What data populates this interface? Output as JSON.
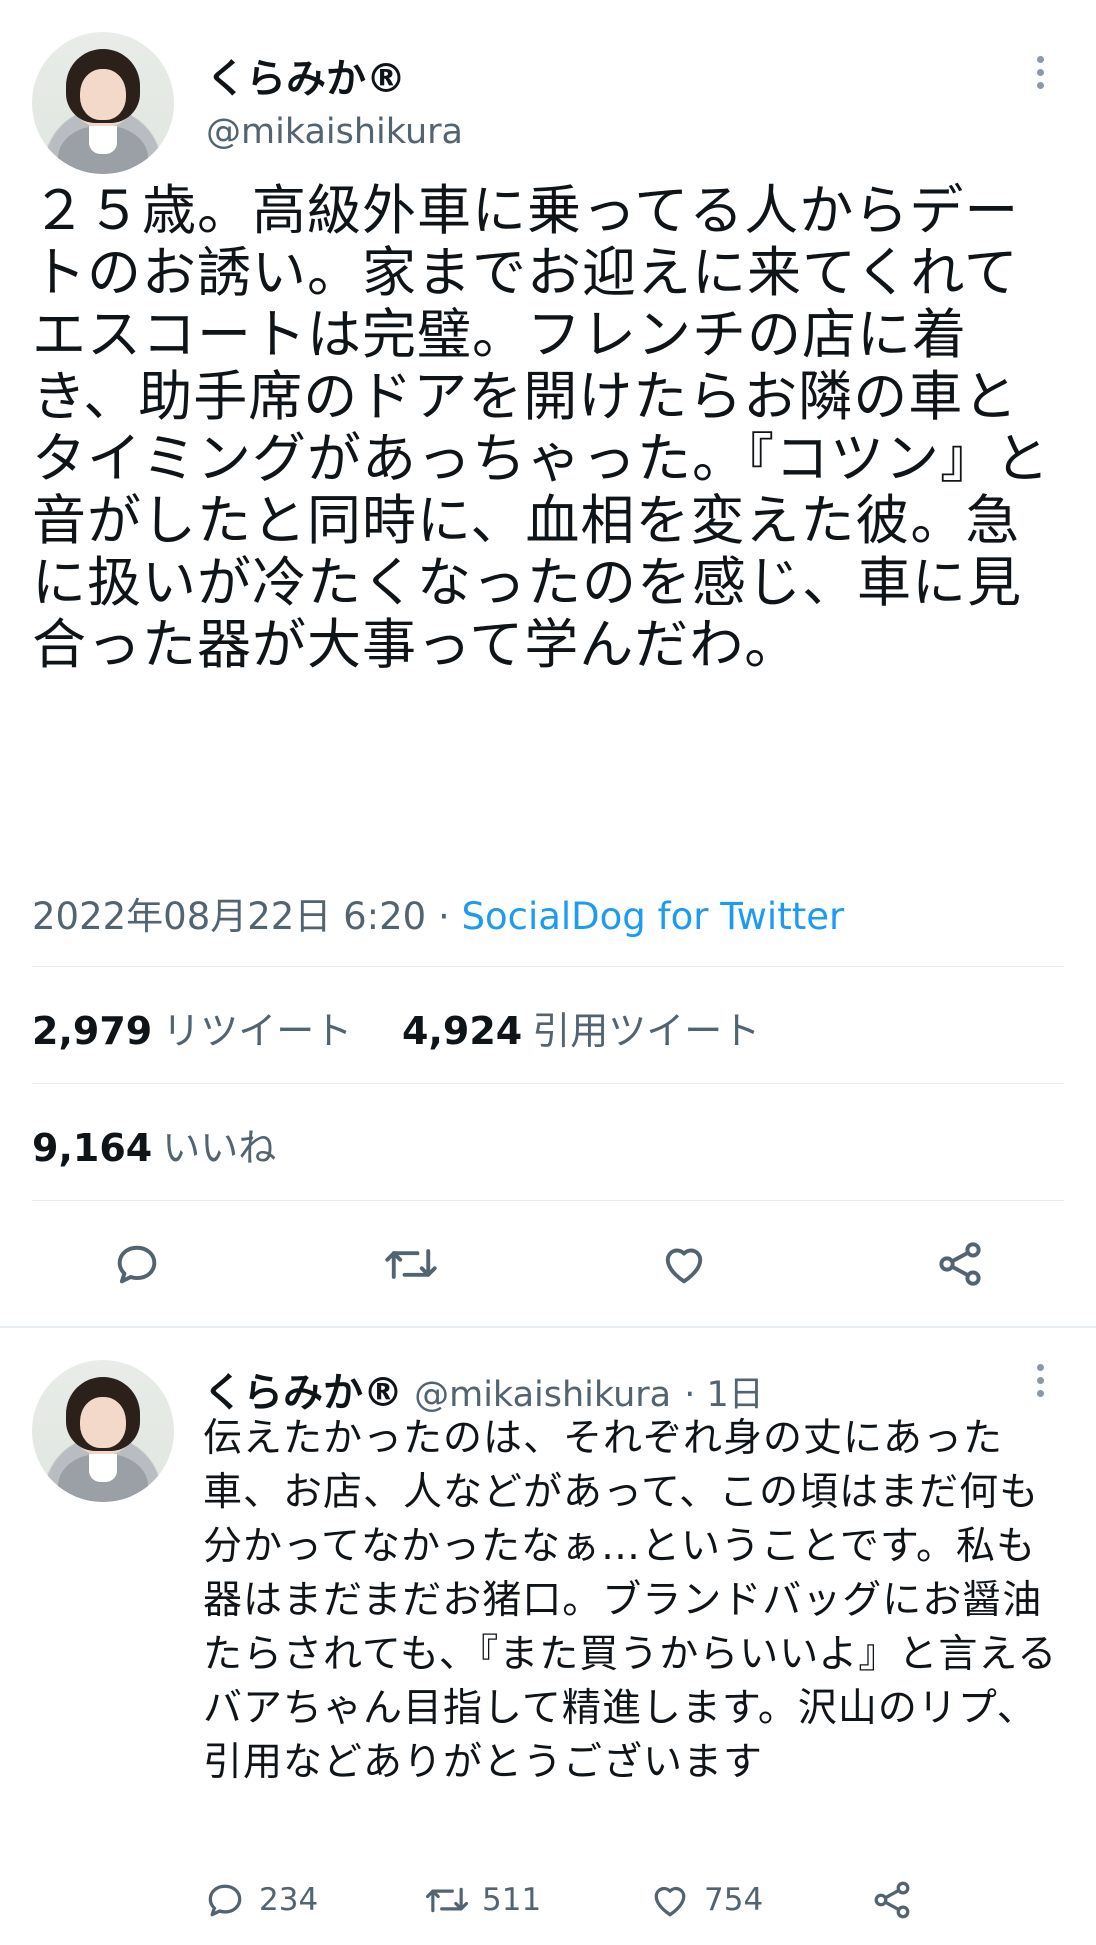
{
  "main_tweet": {
    "display_name": "くらみか®",
    "handle": "@mikaishikura",
    "text": "２５歳。高級外車に乗ってる人からデートのお誘い。家までお迎えに来てくれてエスコートは完璧。フレンチの店に着き、助手席のドアを開けたらお隣の車とタイミングがあっちゃった。『コツン』と音がしたと同時に、血相を変えた彼。急に扱いが冷たくなったのを感じ、車に見合った器が大事って学んだわ。",
    "timestamp": "2022年08月22日 6:20",
    "separator": "·",
    "source": "SocialDog for Twitter",
    "stats": {
      "retweets_count": "2,979",
      "retweets_label": "リツイート",
      "quotes_count": "4,924",
      "quotes_label": "引用ツイート",
      "likes_count": "9,164",
      "likes_label": "いいね"
    }
  },
  "reply_tweet": {
    "display_name": "くらみか®",
    "handle": "@mikaishikura",
    "time": "· 1日",
    "text": "伝えたかったのは、それぞれ身の丈にあった車、お店、人などがあって、この頃はまだ何も分かってなかったなぁ…ということです。私も器はまだまだお猪口。ブランドバッグにお醤油たらされても、『また買うからいいよ』と言えるバアちゃん目指して精進します。沢山のリプ、引用などありがとうございます",
    "counts": {
      "replies": "234",
      "retweets": "511",
      "likes": "754"
    }
  },
  "icons": [
    "reply-icon",
    "retweet-icon",
    "like-icon",
    "share-icon",
    "more-options-icon"
  ],
  "colors": {
    "text": "#0f1419",
    "secondary": "#536471",
    "link": "#1d9bf0",
    "divider": "#e6ecf0"
  }
}
